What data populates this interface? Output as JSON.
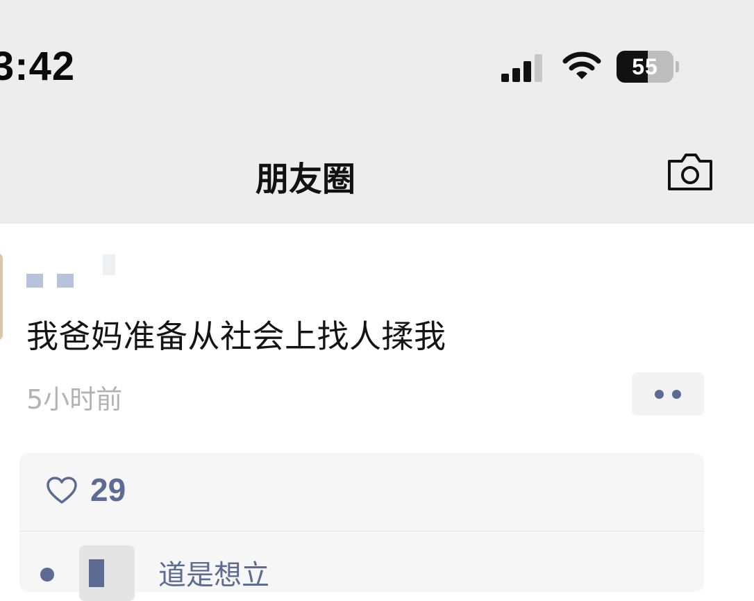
{
  "status_bar": {
    "time": "3:42",
    "battery": "55",
    "battery_level": 0.55
  },
  "nav": {
    "title": "朋友圈",
    "camera_icon": "camera-icon"
  },
  "post": {
    "username": "",
    "text": "我爸妈准备从社会上找人揉我",
    "time": "5小时前",
    "more_icon": "two-dots-icon"
  },
  "likes": {
    "icon": "heart-outline-icon",
    "count": "29"
  },
  "comment": {
    "text": "道是想立"
  },
  "colors": {
    "background": "#ffffff",
    "nav_bg": "#ededed",
    "accent": "#5b6b93",
    "secondary_text": "#b3b3b3"
  }
}
